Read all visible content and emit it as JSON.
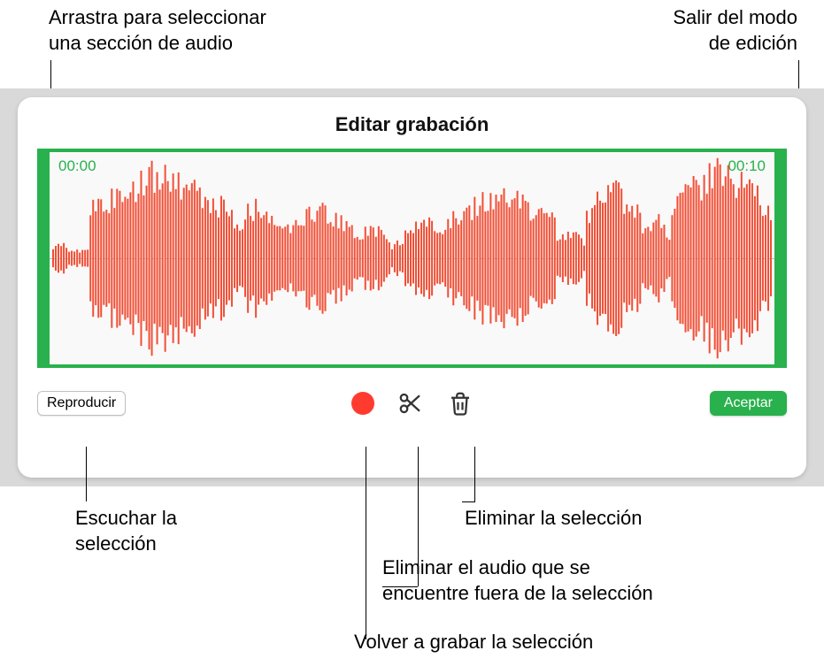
{
  "callouts": {
    "drag_select": "Arrastra para seleccionar\nuna sección de audio",
    "exit_edit": "Salir del modo\nde edición",
    "listen": "Escuchar la\nselección",
    "rerecord": "Volver a grabar la selección",
    "trim_outside": "Eliminar el audio que se\nencuentre fuera de la selección",
    "delete": "Eliminar la selección"
  },
  "panel": {
    "title": "Editar grabación",
    "time_start": "00:00",
    "time_end": "00:10",
    "play_label": "Reproducir",
    "accept_label": "Aceptar"
  },
  "colors": {
    "accent_green": "#28b14c",
    "waveform": "#f24e35",
    "record_red": "#ff3b30"
  },
  "icons": {
    "record": "record-icon",
    "scissors": "scissors-icon",
    "trash": "trash-icon"
  }
}
